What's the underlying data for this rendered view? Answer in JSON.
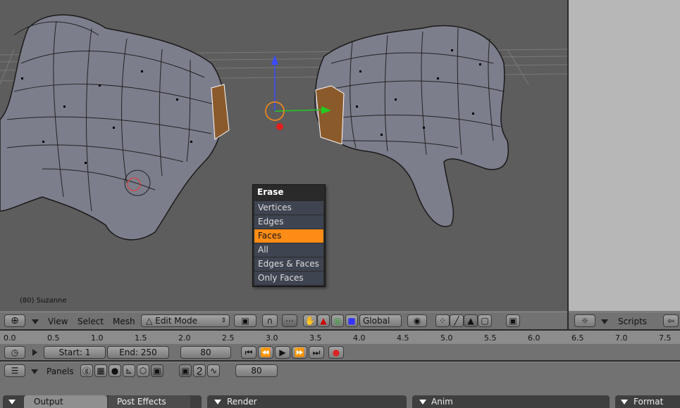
{
  "viewport": {
    "object_label": "(80) Suzanne"
  },
  "popup": {
    "title": "Erase",
    "items": [
      "Vertices",
      "Edges",
      "Faces",
      "All",
      "Edges & Faces",
      "Only Faces"
    ],
    "selected_index": 2
  },
  "header3d": {
    "menus": [
      "View",
      "Select",
      "Mesh"
    ],
    "mode": "Edit Mode",
    "orientation": "Global"
  },
  "scripts_header": {
    "label": "Scripts"
  },
  "timeline": {
    "ticks": [
      "0.0",
      "0.5",
      "1.0",
      "1.5",
      "2.0",
      "2.5",
      "3.0",
      "3.5",
      "4.0",
      "4.5",
      "5.0",
      "5.5",
      "6.0",
      "6.5",
      "7.0",
      "7.5"
    ],
    "start_label": "Start: 1",
    "end_label": "End: 250",
    "current_frame": "80"
  },
  "buttons_header": {
    "panels_label": "Panels",
    "frame": "80"
  },
  "panels": {
    "output_tab": "Output",
    "post_effects_tab": "Post Effects",
    "render": "Render",
    "anim": "Anim",
    "format": "Format"
  },
  "colors": {
    "selection": "#ff8c16",
    "menu_bg": "#2a2a2a",
    "viewport_bg": "#5d5d5d"
  }
}
